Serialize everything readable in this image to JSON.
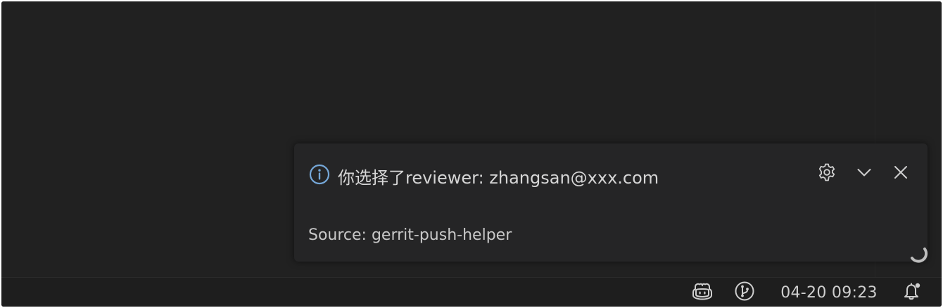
{
  "notification": {
    "severity_icon": "info-icon",
    "message": "你选择了reviewer: zhangsan@xxx.com",
    "source": "Source: gerrit-push-helper",
    "actions": {
      "settings_icon": "gear-icon",
      "collapse_icon": "chevron-down-icon",
      "close_icon": "close-icon"
    }
  },
  "statusbar": {
    "items": [
      {
        "icon": "copilot-icon"
      },
      {
        "icon": "git-graph-icon"
      },
      {
        "label": "04-20 09:23"
      },
      {
        "icon": "bell-dot-icon"
      }
    ]
  },
  "colors": {
    "background": "#212121",
    "notification_bg": "#252526",
    "info_accent": "#75a7d8",
    "text": "#d6d6d6"
  }
}
